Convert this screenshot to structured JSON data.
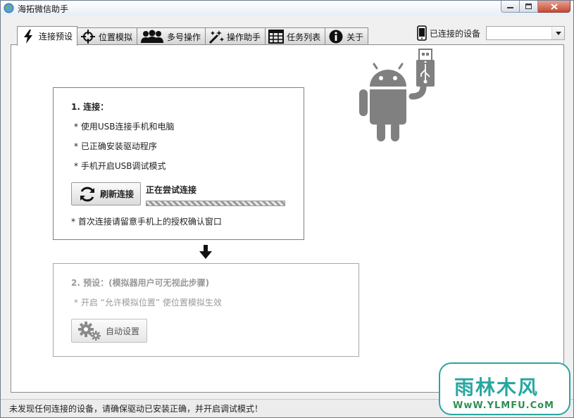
{
  "window": {
    "title": "海拓微信助手",
    "icon": "globe-icon"
  },
  "tabs": [
    {
      "label": "连接预设",
      "icon": "lightning-icon",
      "active": true
    },
    {
      "label": "位置模拟",
      "icon": "crosshair-icon",
      "active": false
    },
    {
      "label": "多号操作",
      "icon": "users-icon",
      "active": false
    },
    {
      "label": "操作助手",
      "icon": "magic-wand-icon",
      "active": false
    },
    {
      "label": "任务列表",
      "icon": "table-icon",
      "active": false
    },
    {
      "label": "关于",
      "icon": "info-icon",
      "active": false
    }
  ],
  "device": {
    "label": "已连接的设备",
    "icon": "phone-icon",
    "selected": ""
  },
  "step1": {
    "heading": "1. 连接：",
    "items": [
      "* 使用USB连接手机和电脑",
      "* 已正确安装驱动程序",
      "* 手机开启USB调试模式"
    ],
    "refresh_button": "刷新连接",
    "status": "正在尝试连接",
    "note": "* 首次连接请留意手机上的授权确认窗口"
  },
  "step2": {
    "heading": "2. 预设：(模拟器用户可无视此步骤)",
    "item": "* 开启 “允许模拟位置” 使位置模拟生效",
    "auto_button": "自动设置"
  },
  "statusbar": {
    "text": "未发现任何连接的设备，请确保驱动已安装正确，并开启调试模式！"
  },
  "watermark": {
    "title": "雨林木风",
    "url": "WwW.YLMFU.CoM"
  },
  "colors": {
    "android_gray": "#808080",
    "watermark_teal": "#28a7a0",
    "watermark_green": "#2f8f53"
  }
}
